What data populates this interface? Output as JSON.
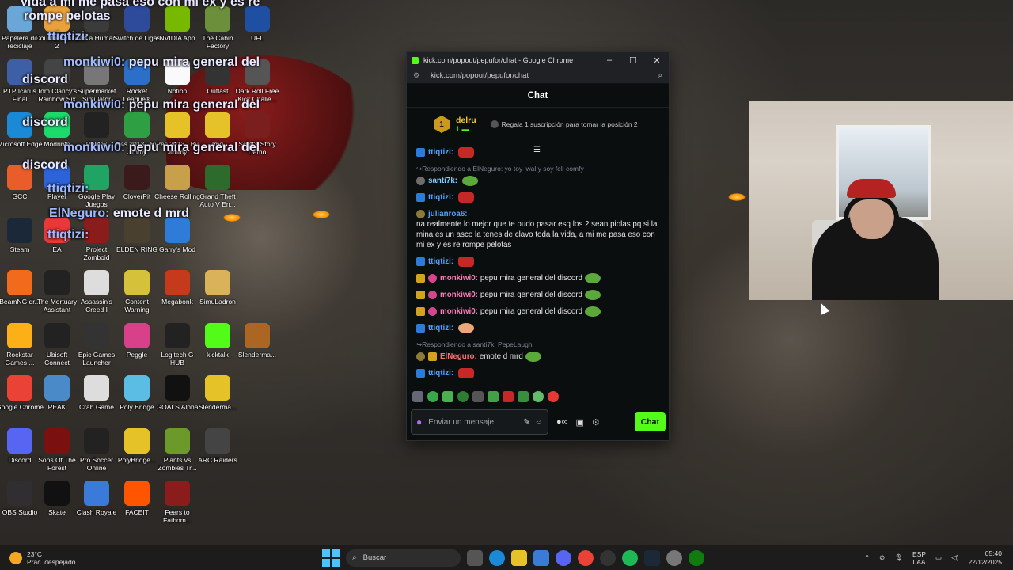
{
  "desktop": {
    "icons": [
      {
        "label": "Papelera de reciclaje",
        "color": "#6aa7d8"
      },
      {
        "label": "Counter-Strike 2",
        "color": "#e9a23b"
      },
      {
        "label": "Not a Human",
        "color": "#3b3b3b"
      },
      {
        "label": "Switch de Ligas",
        "color": "#2e4a9a"
      },
      {
        "label": "NVIDIA App",
        "color": "#76b900"
      },
      {
        "label": "The Cabin Factory",
        "color": "#6b8f3a"
      },
      {
        "label": "UFL",
        "color": "#1e4fa0"
      },
      {
        "label": "PTP Icarus Final",
        "color": "#3d5fa6"
      },
      {
        "label": "Tom Clancy's Rainbow Six",
        "color": "#444"
      },
      {
        "label": "Supermarket Simulator",
        "color": "#777"
      },
      {
        "label": "Rocket League®",
        "color": "#2b6fc9"
      },
      {
        "label": "Notion",
        "color": "#fafafa"
      },
      {
        "label": "Outlast",
        "color": "#333"
      },
      {
        "label": "Dark Roll Free Kick Challe...",
        "color": "#555"
      },
      {
        "label": "Microsoft Edge",
        "color": "#1a8ad6"
      },
      {
        "label": "Modrinth",
        "color": "#1bd96a"
      },
      {
        "label": "Roblox",
        "color": "#222"
      },
      {
        "label": "Pes 2013 - By Jimmy",
        "color": "#2ea043"
      },
      {
        "label": "Pes 2013 - By Jimmy",
        "color": "#e6c229"
      },
      {
        "label": "Img",
        "color": "#e6c229"
      },
      {
        "label": "Scuff's Story Demo",
        "color": "#7a1e1e"
      },
      {
        "label": "GCC",
        "color": "#e85d2a"
      },
      {
        "label": "Player",
        "color": "#2d63d8"
      },
      {
        "label": "Google Play Juegos",
        "color": "#1fa463"
      },
      {
        "label": "CloverPit",
        "color": "#3a1a1a"
      },
      {
        "label": "Cheese Rolling",
        "color": "#c9a04a"
      },
      {
        "label": "Grand Theft Auto V En...",
        "color": "#2d6b2d"
      },
      {
        "label": "Steam",
        "color": "#1b2838"
      },
      {
        "label": "EA",
        "color": "#e83838"
      },
      {
        "label": "Project Zomboid",
        "color": "#8a1c1c"
      },
      {
        "label": "ELDEN RING",
        "color": "#4a4030"
      },
      {
        "label": "Garry's Mod",
        "color": "#2e7bd8"
      },
      {
        "label": "BeamNG.dr...",
        "color": "#f26a1b"
      },
      {
        "label": "The Mortuary Assistant",
        "color": "#222"
      },
      {
        "label": "Assassin's Creed I",
        "color": "#ddd"
      },
      {
        "label": "Content Warning",
        "color": "#d6c23a"
      },
      {
        "label": "Megabonk",
        "color": "#c43a1a"
      },
      {
        "label": "SimuLadron",
        "color": "#d9b25a"
      },
      {
        "label": "Rockstar Games ...",
        "color": "#fcaf17"
      },
      {
        "label": "Ubisoft Connect",
        "color": "#222"
      },
      {
        "label": "Epic Games Launcher",
        "color": "#333"
      },
      {
        "label": "Peggle",
        "color": "#d8408a"
      },
      {
        "label": "Logitech G HUB",
        "color": "#222"
      },
      {
        "label": "kicktalk",
        "color": "#53fc18"
      },
      {
        "label": "Slenderma...",
        "color": "#a62"
      },
      {
        "label": "Google Chrome",
        "color": "#ea4335"
      },
      {
        "label": "PEAK",
        "color": "#4a8ac9"
      },
      {
        "label": "Crab Game",
        "color": "#ddd"
      },
      {
        "label": "Poly Bridge",
        "color": "#5bbce4"
      },
      {
        "label": "GOALS Alpha",
        "color": "#111"
      },
      {
        "label": "Slenderma...",
        "color": "#e6c229"
      },
      {
        "label": "Discord",
        "color": "#5865f2"
      },
      {
        "label": "Sons Of The Forest",
        "color": "#7a1010"
      },
      {
        "label": "Pro Soccer Online",
        "color": "#222"
      },
      {
        "label": "PolyBridge...",
        "color": "#e6c229"
      },
      {
        "label": "Plants vs Zombies Tr...",
        "color": "#6b9a2a"
      },
      {
        "label": "ARC Raiders",
        "color": "#444"
      },
      {
        "label": "OBS Studio",
        "color": "#302e31"
      },
      {
        "label": "Skate",
        "color": "#111"
      },
      {
        "label": "Clash Royale",
        "color": "#3a7ad8"
      },
      {
        "label": "FACEIT",
        "color": "#ff5500"
      },
      {
        "label": "Fears to Fathom...",
        "color": "#8a1c1c"
      }
    ]
  },
  "overlay": {
    "lines": [
      {
        "text": "vida a mi me pasa eso con mi ex y es re"
      },
      {
        "text": "rompe pelotas"
      },
      {
        "user": "ttiqtizi:",
        "text": ""
      },
      {
        "user": "monkiwi0:",
        "text": "pepu mira general del"
      },
      {
        "user": "",
        "text": "discord"
      },
      {
        "user": "monkiwi0:",
        "text": "pepu mira general del"
      },
      {
        "user": "",
        "text": "discord"
      },
      {
        "user": "monkiwi0:",
        "text": "pepu mira general del"
      },
      {
        "user": "",
        "text": "discord"
      },
      {
        "user": "ttiqtizi:",
        "text": ""
      },
      {
        "user": "ElNeguro:",
        "text": "emote d mrd"
      },
      {
        "user": "ttiqtizi:",
        "text": ""
      }
    ]
  },
  "browser": {
    "title": "kick.com/popout/pepufor/chat - Google Chrome",
    "url": "kick.com/popout/pepufor/chat",
    "min_icon": "–",
    "max_icon": "☐",
    "close_icon": "✕",
    "zoom_icon": "⌕"
  },
  "chat": {
    "header": "Chat",
    "pinned": {
      "rank": "1",
      "name": "delru",
      "count": "1",
      "gift_text": "Regala 1 suscripción para tomar la posición 2"
    },
    "messages": [
      {
        "type": "msg",
        "badges": [
          "blue"
        ],
        "user": "ttiqtizi:",
        "user_color": "#4fa3ff",
        "text": "",
        "emote": "red"
      },
      {
        "type": "reply",
        "text": "Respondiendo a ElNeguro: yo toy iwal y soy feli comfy"
      },
      {
        "type": "msg",
        "badges": [
          "grey"
        ],
        "user": "santi7k:",
        "user_color": "#7fd1ff",
        "text": "",
        "emote": "pepe"
      },
      {
        "type": "msg",
        "badges": [
          "blue"
        ],
        "user": "ttiqtizi:",
        "user_color": "#4fa3ff",
        "text": "",
        "emote": "red"
      },
      {
        "type": "msg",
        "badges": [
          "sub"
        ],
        "user": "julianroa6:",
        "user_color": "#4fa3ff",
        "text": "na realmente lo mejor que te pudo pasar esq los 2 sean piolas pq si la mina es un asco la tenes de clavo toda la vida, a mi me pasa eso con mi ex y es re rompe pelotas",
        "emote": ""
      },
      {
        "type": "msg",
        "badges": [
          "blue"
        ],
        "user": "ttiqtizi:",
        "user_color": "#4fa3ff",
        "text": "",
        "emote": "red"
      },
      {
        "type": "msg",
        "badges": [
          "gold",
          "pink"
        ],
        "user": "monkiwi0:",
        "user_color": "#ff7ab8",
        "text": "pepu mira general del discord",
        "emote": "pepe"
      },
      {
        "type": "msg",
        "badges": [
          "gold",
          "pink"
        ],
        "user": "monkiwi0:",
        "user_color": "#ff7ab8",
        "text": "pepu mira general del discord",
        "emote": "pepe"
      },
      {
        "type": "msg",
        "badges": [
          "gold",
          "pink"
        ],
        "user": "monkiwi0:",
        "user_color": "#ff7ab8",
        "text": "pepu mira general del discord",
        "emote": "pepe"
      },
      {
        "type": "msg",
        "badges": [
          "blue"
        ],
        "user": "ttiqtizi:",
        "user_color": "#4fa3ff",
        "text": "",
        "emote": "tan"
      },
      {
        "type": "reply",
        "text": "Respondiendo a santi7k: PepeLaugh"
      },
      {
        "type": "msg",
        "badges": [
          "sub",
          "gold"
        ],
        "user": "ElNeguro:",
        "user_color": "#ff7070",
        "text": "emote d mrd",
        "emote": "pepe"
      },
      {
        "type": "msg",
        "badges": [
          "blue"
        ],
        "user": "ttiqtizi:",
        "user_color": "#4fa3ff",
        "text": "",
        "emote": "red"
      }
    ],
    "input_placeholder": "Enviar un mensaje",
    "send_label": "Chat"
  },
  "taskbar": {
    "temp": "23°C",
    "weather": "Prac. despejado",
    "search_placeholder": "Buscar",
    "lang1": "ESP",
    "lang2": "LAA",
    "time": "05:40",
    "date": "22/12/2025"
  },
  "colors": {
    "kick_green": "#53fc18",
    "chat_bg": "#0b0e0f",
    "taskbar_bg": "#1c1c1c"
  }
}
